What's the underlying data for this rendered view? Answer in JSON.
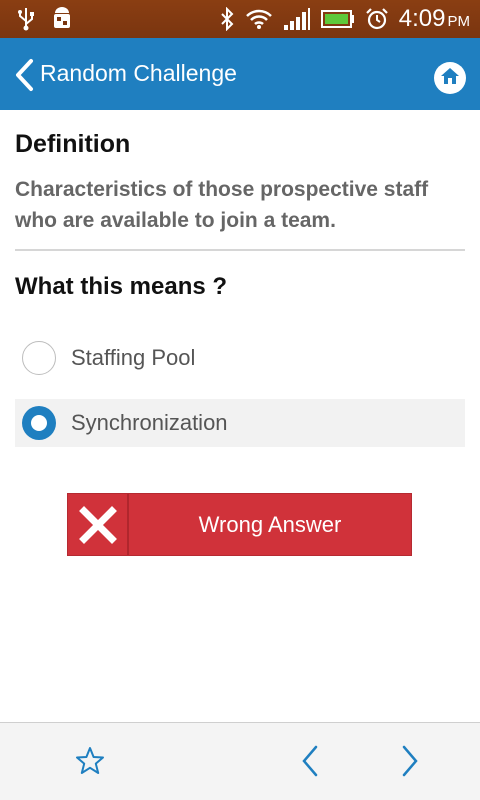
{
  "status_bar": {
    "time": "4:09",
    "ampm": "PM",
    "icons": [
      "usb-icon",
      "android-debug-icon",
      "bluetooth-icon",
      "wifi-icon",
      "signal-icon",
      "battery-icon",
      "alarm-icon"
    ]
  },
  "app_bar": {
    "title": "Random Challenge",
    "back_icon": "chevron-left-icon",
    "home_icon": "home-icon",
    "color": "#1f7fc0"
  },
  "definition": {
    "heading": "Definition",
    "text": "Characteristics of those prospective staff who are available to join a team."
  },
  "question": {
    "heading": "What this means ?",
    "options": [
      {
        "label": "Staffing Pool",
        "selected": false
      },
      {
        "label": "Synchronization",
        "selected": true
      }
    ]
  },
  "result": {
    "label": "Wrong Answer",
    "icon": "close-icon",
    "color": "#d0323a"
  },
  "bottom_bar": {
    "icons": [
      "star-icon",
      "chevron-left-icon",
      "chevron-right-icon"
    ],
    "accent": "#1f7fc0"
  }
}
